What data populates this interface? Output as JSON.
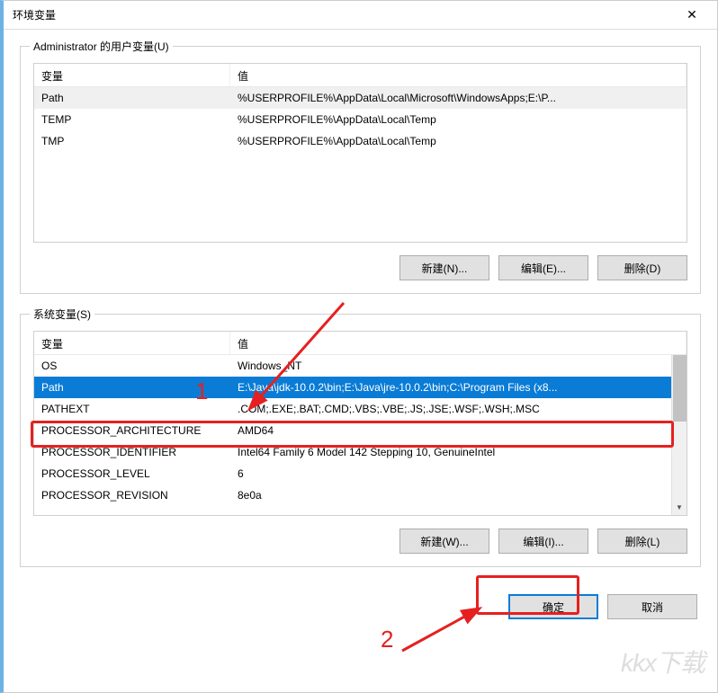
{
  "titlebar": {
    "title": "环境变量",
    "close_icon": "✕"
  },
  "user_vars": {
    "group_label": "Administrator 的用户变量(U)",
    "header_var": "变量",
    "header_val": "值",
    "rows": [
      {
        "var": "Path",
        "val": "%USERPROFILE%\\AppData\\Local\\Microsoft\\WindowsApps;E:\\P..."
      },
      {
        "var": "TEMP",
        "val": "%USERPROFILE%\\AppData\\Local\\Temp"
      },
      {
        "var": "TMP",
        "val": "%USERPROFILE%\\AppData\\Local\\Temp"
      }
    ],
    "btn_new": "新建(N)...",
    "btn_edit": "编辑(E)...",
    "btn_delete": "删除(D)"
  },
  "system_vars": {
    "group_label": "系统变量(S)",
    "header_var": "变量",
    "header_val": "值",
    "rows": [
      {
        "var": "OS",
        "val": "Windows_NT"
      },
      {
        "var": "Path",
        "val": "E:\\Java\\jdk-10.0.2\\bin;E:\\Java\\jre-10.0.2\\bin;C:\\Program Files (x8..."
      },
      {
        "var": "PATHEXT",
        "val": ".COM;.EXE;.BAT;.CMD;.VBS;.VBE;.JS;.JSE;.WSF;.WSH;.MSC"
      },
      {
        "var": "PROCESSOR_ARCHITECTURE",
        "val": "AMD64"
      },
      {
        "var": "PROCESSOR_IDENTIFIER",
        "val": "Intel64 Family 6 Model 142 Stepping 10, GenuineIntel"
      },
      {
        "var": "PROCESSOR_LEVEL",
        "val": "6"
      },
      {
        "var": "PROCESSOR_REVISION",
        "val": "8e0a"
      }
    ],
    "btn_new": "新建(W)...",
    "btn_edit": "编辑(I)...",
    "btn_delete": "删除(L)"
  },
  "dialog_btns": {
    "ok": "确定",
    "cancel": "取消"
  },
  "annotations": {
    "marker1": "1",
    "marker2": "2",
    "watermark": "kkx下载"
  }
}
